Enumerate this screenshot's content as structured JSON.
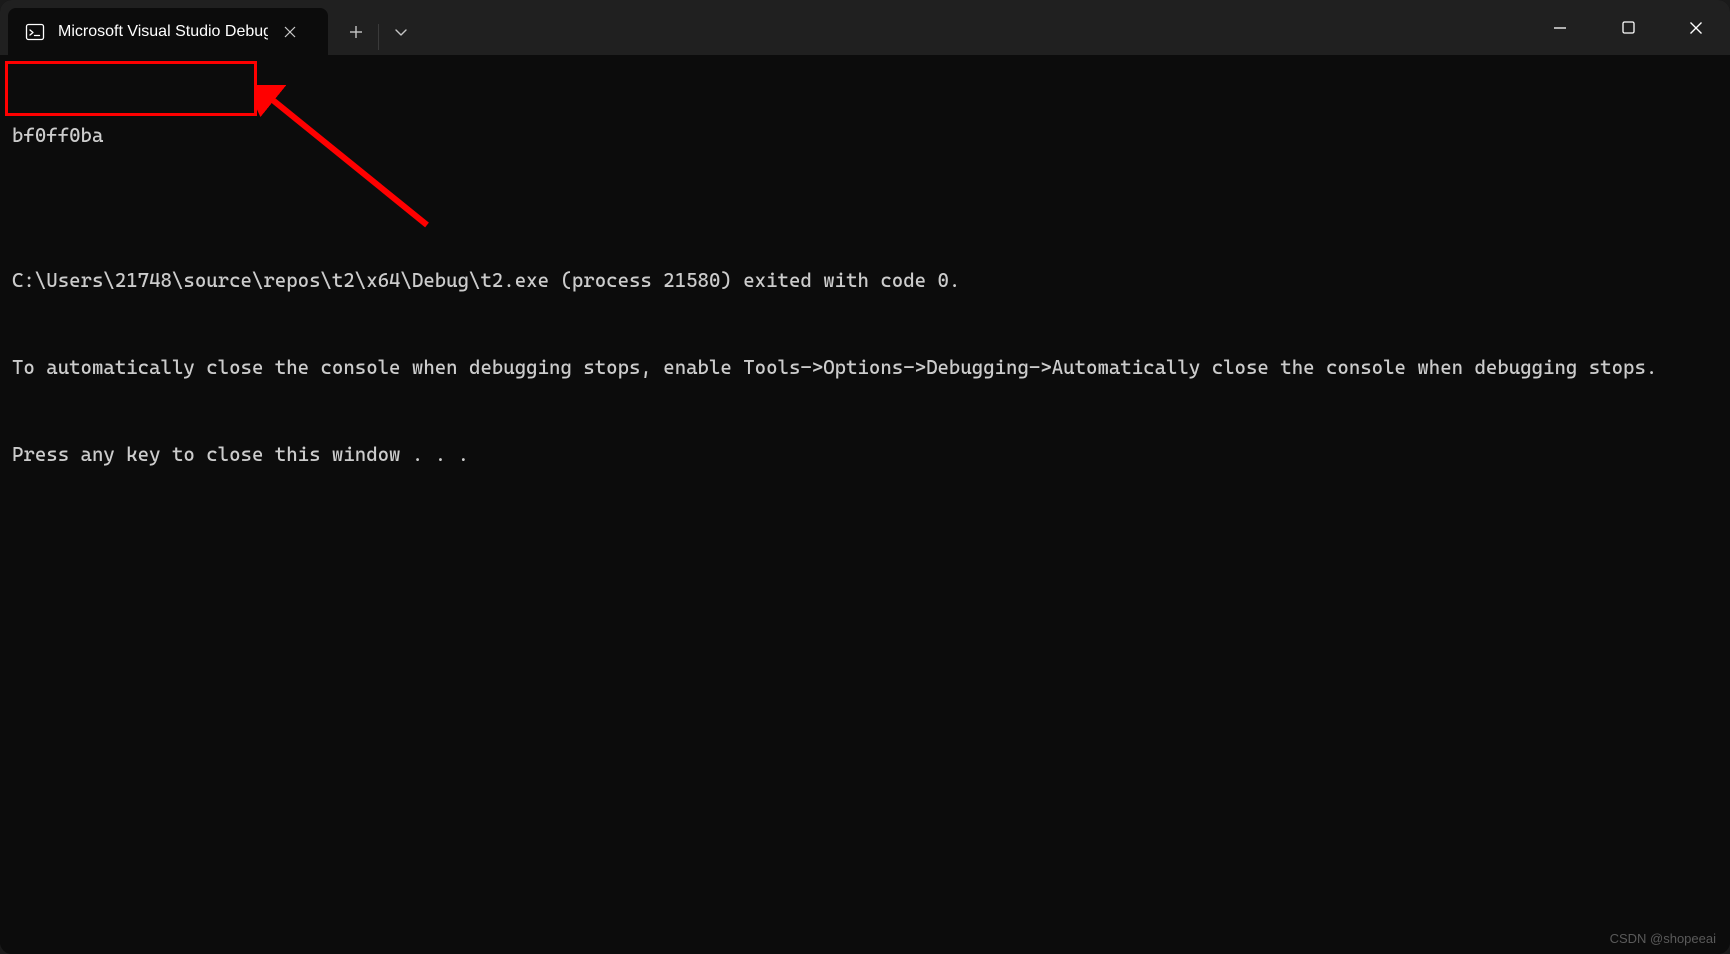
{
  "tab": {
    "title": "Microsoft Visual Studio Debug"
  },
  "terminal": {
    "line1": "bf0ff0ba",
    "line2": "",
    "line3": "C:\\Users\\21748\\source\\repos\\t2\\x64\\Debug\\t2.exe (process 21580) exited with code 0.",
    "line4": "To automatically close the console when debugging stops, enable Tools->Options->Debugging->Automatically close the console when debugging stops.",
    "line5": "Press any key to close this window . . ."
  },
  "watermark": "CSDN @shopeeai"
}
